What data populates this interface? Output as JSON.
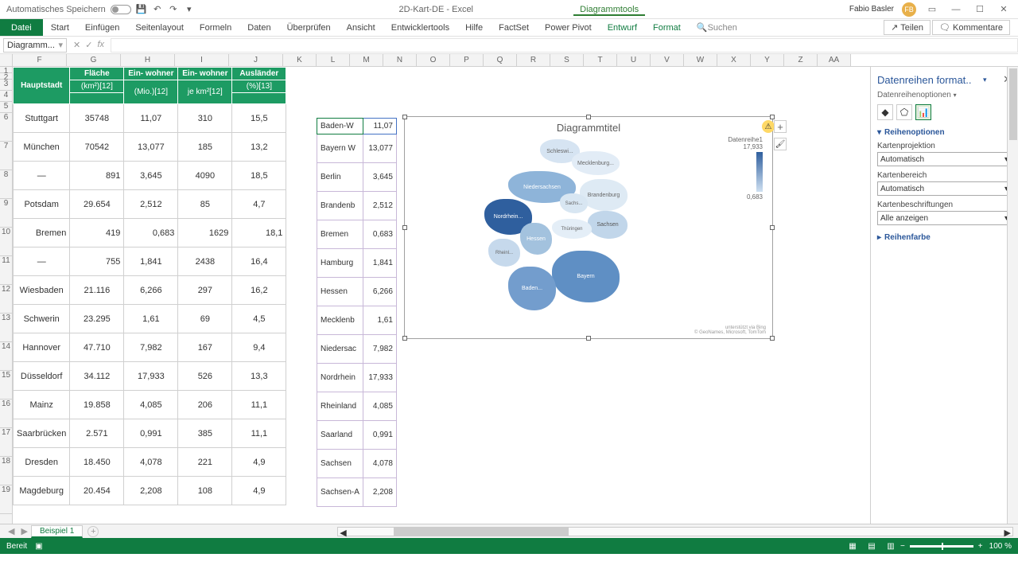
{
  "titlebar": {
    "autosave": "Automatisches Speichern",
    "doc_title": "2D-Kart-DE - Excel",
    "context_tools": "Diagrammtools",
    "user": "Fabio Basler",
    "user_initials": "FB"
  },
  "ribbon": {
    "file": "Datei",
    "tabs": [
      "Start",
      "Einfügen",
      "Seitenlayout",
      "Formeln",
      "Daten",
      "Überprüfen",
      "Ansicht",
      "Entwicklertools",
      "Hilfe",
      "FactSet",
      "Power Pivot"
    ],
    "context_tabs": [
      "Entwurf",
      "Format"
    ],
    "search": "Suchen",
    "share": "Teilen",
    "comments": "Kommentare"
  },
  "namebox": "Diagramm...",
  "columns": [
    "F",
    "G",
    "H",
    "I",
    "J",
    "K",
    "L",
    "M",
    "N",
    "O",
    "P",
    "Q",
    "R",
    "S",
    "T",
    "U",
    "V",
    "W",
    "X",
    "Y",
    "Z",
    "AA"
  ],
  "rownums": [
    1,
    2,
    3,
    4,
    5,
    6,
    7,
    8,
    9,
    10,
    11,
    12,
    13,
    14,
    15,
    16,
    17,
    18,
    19
  ],
  "table": {
    "headers": {
      "hauptstadt": "Hauptstadt",
      "flaeche": "Fläche",
      "flaeche_u": "(km²)[12]",
      "einwohner": "Ein-\nwohner",
      "einwohner_u": "(Mio.)[12]",
      "einwohner2": "Ein-\nwohner",
      "einwohner2_u": "je km²[12]",
      "auslaender": "Ausländer",
      "auslaender_u": "(%)[13]"
    },
    "rows": [
      {
        "h": "Stuttgart",
        "f": "35748",
        "e": "11,07",
        "d": "310",
        "a": "15,5"
      },
      {
        "h": "München",
        "f": "70542",
        "e": "13,077",
        "d": "185",
        "a": "13,2"
      },
      {
        "h": "—",
        "f": "891",
        "e": "3,645",
        "d": "4090",
        "a": "18,5"
      },
      {
        "h": "Potsdam",
        "f": "29.654",
        "e": "2,512",
        "d": "85",
        "a": "4,7"
      },
      {
        "h": "Bremen",
        "f": "419",
        "e": "0,683",
        "d": "1629",
        "a": "18,1"
      },
      {
        "h": "—",
        "f": "755",
        "e": "1,841",
        "d": "2438",
        "a": "16,4"
      },
      {
        "h": "Wiesbaden",
        "f": "21.116",
        "e": "6,266",
        "d": "297",
        "a": "16,2"
      },
      {
        "h": "Schwerin",
        "f": "23.295",
        "e": "1,61",
        "d": "69",
        "a": "4,5"
      },
      {
        "h": "Hannover",
        "f": "47.710",
        "e": "7,982",
        "d": "167",
        "a": "9,4"
      },
      {
        "h": "Düsseldorf",
        "f": "34.112",
        "e": "17,933",
        "d": "526",
        "a": "13,3"
      },
      {
        "h": "Mainz",
        "f": "19.858",
        "e": "4,085",
        "d": "206",
        "a": "11,1"
      },
      {
        "h": "Saarbrücken",
        "f": "2.571",
        "e": "0,991",
        "d": "385",
        "a": "11,1"
      },
      {
        "h": "Dresden",
        "f": "18.450",
        "e": "4,078",
        "d": "221",
        "a": "4,9"
      },
      {
        "h": "Magdeburg",
        "f": "20.454",
        "e": "2,208",
        "d": "108",
        "a": "4,9"
      }
    ]
  },
  "kl_col_widths": {
    "k": 42,
    "l": 42
  },
  "kl": [
    {
      "k": "Baden-W",
      "l": "11,07"
    },
    {
      "k": "Bayern W",
      "l": "13,077"
    },
    {
      "k": "Berlin",
      "l": "3,645"
    },
    {
      "k": "Brandenb",
      "l": "2,512"
    },
    {
      "k": "Bremen",
      "l": "0,683"
    },
    {
      "k": "Hamburg",
      "l": "1,841"
    },
    {
      "k": "Hessen",
      "l": "6,266"
    },
    {
      "k": "Mecklenb",
      "l": "1,61"
    },
    {
      "k": "Niedersac",
      "l": "7,982"
    },
    {
      "k": "Nordrhein",
      "l": "17,933"
    },
    {
      "k": "Rheinland",
      "l": "4,085"
    },
    {
      "k": "Saarland",
      "l": "0,991"
    },
    {
      "k": "Sachsen",
      "l": "4,078"
    },
    {
      "k": "Sachsen-A",
      "l": "2,208"
    }
  ],
  "chart": {
    "title": "Diagrammtitel",
    "legend_name": "Datenreihe1",
    "legend_max": "17,933",
    "legend_min": "0,683",
    "attribution1": "unterstützt via Bing",
    "attribution2": "© GeoNames, Microsoft, TomTom",
    "labels": [
      "Schleswi...",
      "Mecklenburg...",
      "Niedersachsen",
      "Brandenburg",
      "Sachs...",
      "Sachsen",
      "Nordrhein...",
      "Thüringen",
      "Hessen",
      "Rheinl...",
      "Bayern",
      "Baden..."
    ]
  },
  "chart_data": {
    "type": "map",
    "region": "Germany States",
    "title": "Diagrammtitel",
    "series_name": "Datenreihe1",
    "scale_min": 0.683,
    "scale_max": 17.933,
    "data": [
      {
        "state": "Baden-Württemberg",
        "value": 11.07
      },
      {
        "state": "Bayern",
        "value": 13.077
      },
      {
        "state": "Berlin",
        "value": 3.645
      },
      {
        "state": "Brandenburg",
        "value": 2.512
      },
      {
        "state": "Bremen",
        "value": 0.683
      },
      {
        "state": "Hamburg",
        "value": 1.841
      },
      {
        "state": "Hessen",
        "value": 6.266
      },
      {
        "state": "Mecklenburg-Vorpommern",
        "value": 1.61
      },
      {
        "state": "Niedersachsen",
        "value": 7.982
      },
      {
        "state": "Nordrhein-Westfalen",
        "value": 17.933
      },
      {
        "state": "Rheinland-Pfalz",
        "value": 4.085
      },
      {
        "state": "Saarland",
        "value": 0.991
      },
      {
        "state": "Sachsen",
        "value": 4.078
      },
      {
        "state": "Sachsen-Anhalt",
        "value": 2.208
      }
    ]
  },
  "side_panel": {
    "title": "Datenreihen format..",
    "subtitle": "Datenreihenoptionen",
    "section1": "Reihenoptionen",
    "field1_label": "Kartenprojektion",
    "field1_value": "Automatisch",
    "field2_label": "Kartenbereich",
    "field2_value": "Automatisch",
    "field3_label": "Kartenbeschriftungen",
    "field3_value": "Alle anzeigen",
    "section2": "Reihenfarbe"
  },
  "sheet": {
    "tab": "Beispiel 1"
  },
  "status": {
    "ready": "Bereit",
    "zoom": "100 %"
  }
}
